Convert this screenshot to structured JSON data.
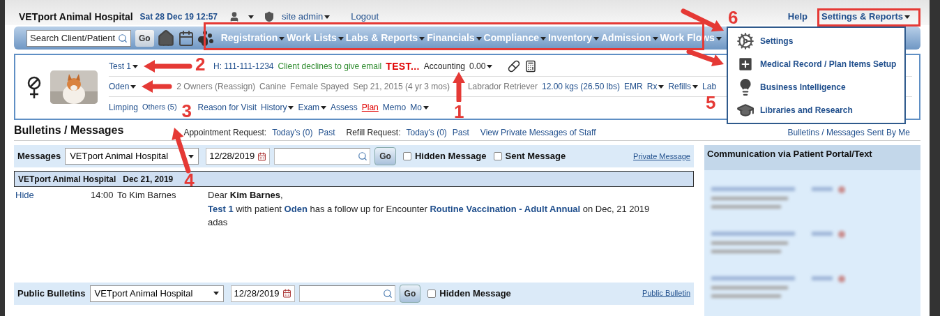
{
  "header": {
    "hospital": "VETport Animal Hospital",
    "datetime": "Sat 28 Dec 19 12:57",
    "user": "site admin",
    "logout": "Logout",
    "help": "Help",
    "settings_reports": "Settings & Reports"
  },
  "search": {
    "placeholder": "Search Client/Patient",
    "go": "Go"
  },
  "nav_menu": [
    "Registration",
    "Work Lists",
    "Labs & Reports",
    "Financials",
    "Compliance",
    "Inventory",
    "Admission",
    "Work Flows"
  ],
  "patient": {
    "lines": [
      {
        "items": [
          {
            "text": "Test 1",
            "kind": "link",
            "caret": true
          },
          {
            "text": "H: 111-111-1234",
            "kind": "link",
            "caret": false
          },
          {
            "text": "Client declines to give email",
            "kind": "green",
            "caret": false
          },
          {
            "text": "TEST...",
            "kind": "alert",
            "caret": false
          },
          {
            "text": "Accounting",
            "kind": "plain",
            "caret": false
          },
          {
            "text": "0.00",
            "kind": "plain",
            "caret": true
          }
        ]
      },
      {
        "items": [
          {
            "text": "Oden",
            "kind": "link",
            "caret": true
          },
          {
            "text": "2 Owners (Reassign)",
            "kind": "muted",
            "caret": false
          },
          {
            "text": "Canine",
            "kind": "muted",
            "caret": false
          },
          {
            "text": "Female Spayed",
            "kind": "muted",
            "caret": false
          },
          {
            "text": "Sep 21, 2015 (4 yr 3 mos)",
            "kind": "muted",
            "caret": false
          },
          {
            "text": "Labrador Retriever",
            "kind": "muted",
            "caret": false
          },
          {
            "text": "12.00 kgs (26.50 lbs)",
            "kind": "link",
            "caret": false
          },
          {
            "text": "EMR",
            "kind": "link",
            "caret": false
          },
          {
            "text": "Rx",
            "kind": "link",
            "caret": true
          },
          {
            "text": "Refills",
            "kind": "link",
            "caret": true
          },
          {
            "text": "Lab",
            "kind": "link",
            "caret": false
          }
        ]
      },
      {
        "items": [
          {
            "text": "Limping",
            "kind": "link",
            "caret": false
          },
          {
            "text": "Others (5)",
            "kind": "small",
            "caret": false
          },
          {
            "text": "Reason for Visit",
            "kind": "link",
            "caret": false
          },
          {
            "text": "History",
            "kind": "link",
            "caret": true
          },
          {
            "text": "Exam",
            "kind": "link",
            "caret": true
          },
          {
            "text": "Assess",
            "kind": "link",
            "caret": false
          },
          {
            "text": "Plan",
            "kind": "underlined",
            "caret": false
          },
          {
            "text": "Memo",
            "kind": "link",
            "caret": false
          },
          {
            "text": "Mo",
            "kind": "link",
            "caret": true
          }
        ]
      }
    ]
  },
  "bulletins": {
    "title": "Bulletins / Messages",
    "links": [
      {
        "text": "Appointment Request:",
        "kind": "plain"
      },
      {
        "text": "Today's (0)",
        "kind": "link"
      },
      {
        "text": "Past",
        "kind": "link"
      },
      {
        "text": "Refill Request:",
        "kind": "plain"
      },
      {
        "text": "Today's (0)",
        "kind": "link"
      },
      {
        "text": "Past",
        "kind": "link"
      },
      {
        "text": "View Private Messages of Staff",
        "kind": "link"
      }
    ],
    "sent_by_me": "Bulletins / Messages Sent By Me"
  },
  "messages_filter": {
    "label": "Messages",
    "select": "VETport Animal Hospital",
    "date": "12/28/2019",
    "go": "Go",
    "checks": [
      {
        "label": "Hidden Message",
        "checked": false
      },
      {
        "label": "Sent Message",
        "checked": false
      }
    ],
    "link": "Private Message"
  },
  "message_group": {
    "clinic": "VETport Animal Hospital",
    "date": "Dec 21, 2019"
  },
  "message": {
    "action": "Hide",
    "time": "14:00",
    "to": "To Kim Barnes",
    "lines": [
      [
        {
          "text": "Dear ",
          "kind": "plain"
        },
        {
          "text": "Kim Barnes",
          "kind": "bold"
        },
        {
          "text": ",",
          "kind": "plain"
        }
      ],
      [
        {
          "text": "Test 1",
          "kind": "link"
        },
        {
          "text": " with patient ",
          "kind": "plain"
        },
        {
          "text": "Oden",
          "kind": "link"
        },
        {
          "text": " has a follow up for Encounter ",
          "kind": "plain"
        },
        {
          "text": "Routine Vaccination - Adult Annual",
          "kind": "link"
        },
        {
          "text": " on Dec, 21 2019",
          "kind": "plain"
        }
      ],
      [
        {
          "text": "adas",
          "kind": "plain"
        }
      ]
    ]
  },
  "public_filter": {
    "label": "Public Bulletins",
    "select": "VETport Animal Hospital",
    "date": "12/28/2019",
    "go": "Go",
    "checks": [
      {
        "label": "Hidden Message",
        "checked": false
      }
    ],
    "link": "Public Bulletin"
  },
  "portal": {
    "title": "Communication via Patient Portal/Text"
  },
  "settings_menu": [
    {
      "label": "Settings",
      "kind": "gear"
    },
    {
      "label": "Medical Record / Plan Items Setup",
      "kind": "plus"
    },
    {
      "label": "Business Intelligence",
      "kind": "bulb"
    },
    {
      "label": "Libraries and Research",
      "kind": "cap"
    }
  ],
  "annotations": [
    "1",
    "2",
    "3",
    "4",
    "5",
    "6"
  ]
}
